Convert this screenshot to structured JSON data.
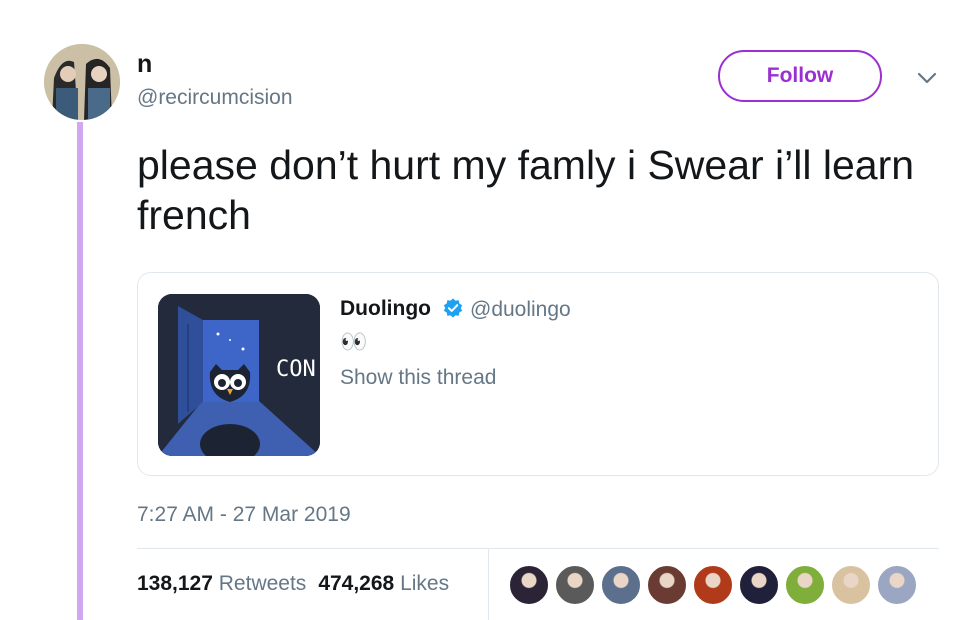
{
  "author": {
    "name": "n",
    "handle": "@recircumcision"
  },
  "follow_label": "Follow",
  "tweet_text": "please  don’t  hurt my famly i Swear i’ll learn french",
  "quoted": {
    "name": "Duolingo",
    "handle": "@duolingo",
    "body": "👀",
    "link_label": "Show this thread",
    "media_text": "CON"
  },
  "timestamp": "7:27 AM - 27 Mar 2019",
  "stats": {
    "retweets_count": "138,127",
    "retweets_label": "Retweets",
    "likes_count": "474,268",
    "likes_label": "Likes"
  },
  "colors": {
    "accent": "#9b2fd2",
    "thread_line": "#cfa8f0",
    "verified": "#1da1f2",
    "muted": "#657786"
  },
  "liker_avatar_colors": [
    "#2b2336",
    "#5a5a5a",
    "#5c6f8c",
    "#6a3b33",
    "#b03a1a",
    "#20203a",
    "#7fae3a",
    "#d9c2a0",
    "#9aa6c2"
  ]
}
